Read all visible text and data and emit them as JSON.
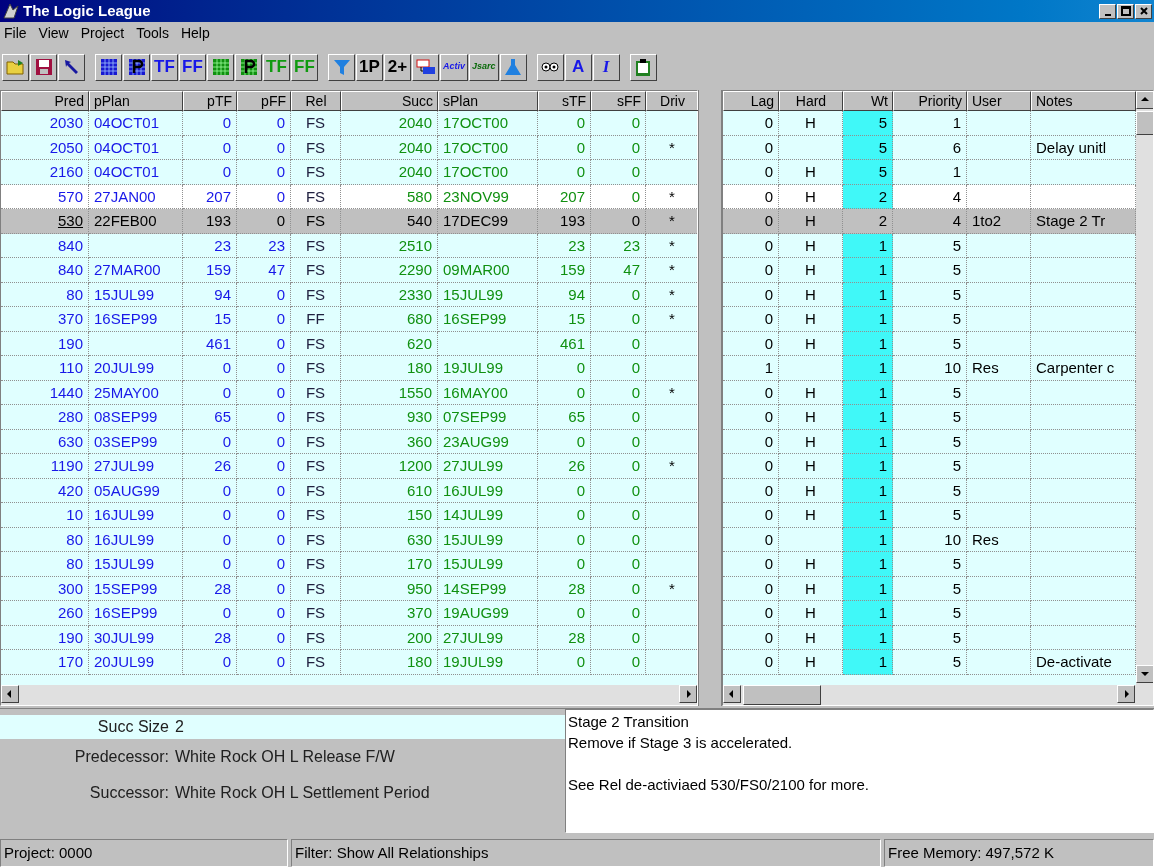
{
  "window": {
    "title": "The Logic League"
  },
  "menu": [
    "File",
    "View",
    "Project",
    "Tools",
    "Help"
  ],
  "toolbar": [
    {
      "kind": "icon"
    },
    {
      "kind": "icon"
    },
    {
      "kind": "icon"
    },
    {
      "kind": "separator"
    },
    {
      "kind": "icon"
    },
    {
      "kind": "icon"
    },
    {
      "kind": "text",
      "label": "TF",
      "color": "#1818e8"
    },
    {
      "kind": "text",
      "label": "FF",
      "color": "#1818e8"
    },
    {
      "kind": "icon"
    },
    {
      "kind": "icon"
    },
    {
      "kind": "text",
      "label": "TF",
      "color": "#109a10"
    },
    {
      "kind": "text",
      "label": "FF",
      "color": "#109a10"
    },
    {
      "kind": "separator"
    },
    {
      "kind": "icon"
    },
    {
      "kind": "text",
      "label": "1P",
      "color": "#000000"
    },
    {
      "kind": "text",
      "label": "2+",
      "color": "#000000"
    },
    {
      "kind": "icon"
    },
    {
      "kind": "small",
      "label": "Activ",
      "color": "#1818e8"
    },
    {
      "kind": "small",
      "label": "Jsarc",
      "color": "#0a6a0a"
    },
    {
      "kind": "icon"
    },
    {
      "kind": "separator"
    },
    {
      "kind": "icon"
    },
    {
      "kind": "text",
      "label": "A",
      "color": "#1818e8"
    },
    {
      "kind": "italic",
      "label": "I",
      "color": "#1818e8"
    },
    {
      "kind": "separator"
    },
    {
      "kind": "icon"
    }
  ],
  "left_grid": {
    "columns": [
      "Pred",
      "pPlan",
      "pTF",
      "pFF",
      "Rel",
      "Succ",
      "sPlan",
      "sTF",
      "sFF",
      "Driv"
    ]
  },
  "right_grid": {
    "columns": [
      "Lag",
      "Hard",
      "Wt",
      "Priority",
      "User",
      "Notes"
    ]
  },
  "rows": [
    {
      "selected": false,
      "highlighted": false,
      "pred": "2030",
      "pplan": "04OCT01",
      "ptf": "0",
      "pff": "0",
      "rel": "FS",
      "succ": "2040",
      "splan": "17OCT00",
      "stf": "0",
      "sff": "0",
      "lag": "0",
      "hard": "H",
      "wt": "5",
      "priority": "1"
    },
    {
      "selected": false,
      "highlighted": false,
      "pred": "2050",
      "pplan": "04OCT01",
      "ptf": "0",
      "pff": "0",
      "rel": "FS",
      "succ": "2040",
      "splan": "17OCT00",
      "stf": "0",
      "sff": "0",
      "driv": "*",
      "lag": "0",
      "wt": "5",
      "priority": "6",
      "notes": "Delay unitl"
    },
    {
      "selected": false,
      "highlighted": false,
      "pred": "2160",
      "pplan": "04OCT01",
      "ptf": "0",
      "pff": "0",
      "rel": "FS",
      "succ": "2040",
      "splan": "17OCT00",
      "stf": "0",
      "sff": "0",
      "lag": "0",
      "hard": "H",
      "wt": "5",
      "priority": "1"
    },
    {
      "selected": false,
      "highlighted": true,
      "pred": "570",
      "pplan": "27JAN00",
      "ptf": "207",
      "pff": "0",
      "rel": "FS",
      "succ": "580",
      "splan": "23NOV99",
      "stf": "207",
      "sff": "0",
      "driv": "*",
      "lag": "0",
      "hard": "H",
      "wt": "2",
      "priority": "4"
    },
    {
      "selected": true,
      "highlighted": false,
      "pred": "530",
      "pplan": "22FEB00",
      "ptf": "193",
      "pff": "0",
      "rel": "FS",
      "succ": "540",
      "splan": "17DEC99",
      "stf": "193",
      "sff": "0",
      "driv": "*",
      "lag": "0",
      "hard": "H",
      "wt": "2",
      "priority": "4",
      "user": "1to2",
      "notes": "Stage 2 Tr"
    },
    {
      "selected": false,
      "highlighted": false,
      "pred": "840",
      "ptf": "23",
      "pff": "23",
      "rel": "FS",
      "succ": "2510",
      "stf": "23",
      "sff": "23",
      "driv": "*",
      "lag": "0",
      "hard": "H",
      "wt": "1",
      "priority": "5"
    },
    {
      "selected": false,
      "highlighted": false,
      "pred": "840",
      "pplan": "27MAR00",
      "ptf": "159",
      "pff": "47",
      "rel": "FS",
      "succ": "2290",
      "splan": "09MAR00",
      "stf": "159",
      "sff": "47",
      "driv": "*",
      "lag": "0",
      "hard": "H",
      "wt": "1",
      "priority": "5"
    },
    {
      "selected": false,
      "highlighted": false,
      "pred": "80",
      "pplan": "15JUL99",
      "ptf": "94",
      "pff": "0",
      "rel": "FS",
      "succ": "2330",
      "splan": "15JUL99",
      "stf": "94",
      "sff": "0",
      "driv": "*",
      "lag": "0",
      "hard": "H",
      "wt": "1",
      "priority": "5"
    },
    {
      "selected": false,
      "highlighted": false,
      "pred": "370",
      "pplan": "16SEP99",
      "ptf": "15",
      "pff": "0",
      "rel": "FF",
      "succ": "680",
      "splan": "16SEP99",
      "stf": "15",
      "sff": "0",
      "driv": "*",
      "lag": "0",
      "hard": "H",
      "wt": "1",
      "priority": "5"
    },
    {
      "selected": false,
      "highlighted": false,
      "pred": "190",
      "ptf": "461",
      "pff": "0",
      "rel": "FS",
      "succ": "620",
      "stf": "461",
      "sff": "0",
      "lag": "0",
      "hard": "H",
      "wt": "1",
      "priority": "5"
    },
    {
      "selected": false,
      "highlighted": false,
      "pred": "110",
      "pplan": "20JUL99",
      "ptf": "0",
      "pff": "0",
      "rel": "FS",
      "succ": "180",
      "splan": "19JUL99",
      "stf": "0",
      "sff": "0",
      "lag": "1",
      "wt": "1",
      "priority": "10",
      "user": "Res",
      "notes": "Carpenter c"
    },
    {
      "selected": false,
      "highlighted": false,
      "pred": "1440",
      "pplan": "25MAY00",
      "ptf": "0",
      "pff": "0",
      "rel": "FS",
      "succ": "1550",
      "splan": "16MAY00",
      "stf": "0",
      "sff": "0",
      "driv": "*",
      "lag": "0",
      "hard": "H",
      "wt": "1",
      "priority": "5"
    },
    {
      "selected": false,
      "highlighted": false,
      "pred": "280",
      "pplan": "08SEP99",
      "ptf": "65",
      "pff": "0",
      "rel": "FS",
      "succ": "930",
      "splan": "07SEP99",
      "stf": "65",
      "sff": "0",
      "lag": "0",
      "hard": "H",
      "wt": "1",
      "priority": "5"
    },
    {
      "selected": false,
      "highlighted": false,
      "pred": "630",
      "pplan": "03SEP99",
      "ptf": "0",
      "pff": "0",
      "rel": "FS",
      "succ": "360",
      "splan": "23AUG99",
      "stf": "0",
      "sff": "0",
      "lag": "0",
      "hard": "H",
      "wt": "1",
      "priority": "5"
    },
    {
      "selected": false,
      "highlighted": false,
      "pred": "1190",
      "pplan": "27JUL99",
      "ptf": "26",
      "pff": "0",
      "rel": "FS",
      "succ": "1200",
      "splan": "27JUL99",
      "stf": "26",
      "sff": "0",
      "driv": "*",
      "lag": "0",
      "hard": "H",
      "wt": "1",
      "priority": "5"
    },
    {
      "selected": false,
      "highlighted": false,
      "pred": "420",
      "pplan": "05AUG99",
      "ptf": "0",
      "pff": "0",
      "rel": "FS",
      "succ": "610",
      "splan": "16JUL99",
      "stf": "0",
      "sff": "0",
      "lag": "0",
      "hard": "H",
      "wt": "1",
      "priority": "5"
    },
    {
      "selected": false,
      "highlighted": false,
      "pred": "10",
      "pplan": "16JUL99",
      "ptf": "0",
      "pff": "0",
      "rel": "FS",
      "succ": "150",
      "splan": "14JUL99",
      "stf": "0",
      "sff": "0",
      "lag": "0",
      "hard": "H",
      "wt": "1",
      "priority": "5"
    },
    {
      "selected": false,
      "highlighted": false,
      "pred": "80",
      "pplan": "16JUL99",
      "ptf": "0",
      "pff": "0",
      "rel": "FS",
      "succ": "630",
      "splan": "15JUL99",
      "stf": "0",
      "sff": "0",
      "lag": "0",
      "wt": "1",
      "priority": "10",
      "user": "Res"
    },
    {
      "selected": false,
      "highlighted": false,
      "pred": "80",
      "pplan": "15JUL99",
      "ptf": "0",
      "pff": "0",
      "rel": "FS",
      "succ": "170",
      "splan": "15JUL99",
      "stf": "0",
      "sff": "0",
      "lag": "0",
      "hard": "H",
      "wt": "1",
      "priority": "5"
    },
    {
      "selected": false,
      "highlighted": false,
      "pred": "300",
      "pplan": "15SEP99",
      "ptf": "28",
      "pff": "0",
      "rel": "FS",
      "succ": "950",
      "splan": "14SEP99",
      "stf": "28",
      "sff": "0",
      "driv": "*",
      "lag": "0",
      "hard": "H",
      "wt": "1",
      "priority": "5"
    },
    {
      "selected": false,
      "highlighted": false,
      "pred": "260",
      "pplan": "16SEP99",
      "ptf": "0",
      "pff": "0",
      "rel": "FS",
      "succ": "370",
      "splan": "19AUG99",
      "stf": "0",
      "sff": "0",
      "lag": "0",
      "hard": "H",
      "wt": "1",
      "priority": "5"
    },
    {
      "selected": false,
      "highlighted": false,
      "pred": "190",
      "pplan": "30JUL99",
      "ptf": "28",
      "pff": "0",
      "rel": "FS",
      "succ": "200",
      "splan": "27JUL99",
      "stf": "28",
      "sff": "0",
      "lag": "0",
      "hard": "H",
      "wt": "1",
      "priority": "5"
    },
    {
      "selected": false,
      "highlighted": false,
      "pred": "170",
      "pplan": "20JUL99",
      "ptf": "0",
      "pff": "0",
      "rel": "FS",
      "succ": "180",
      "splan": "19JUL99",
      "stf": "0",
      "sff": "0",
      "lag": "0",
      "hard": "H",
      "wt": "1",
      "priority": "5",
      "notes": "De-activate"
    }
  ],
  "details": {
    "succ_size_label": "Succ Size",
    "succ_size": "2",
    "predecessor_label": "Predecessor:",
    "predecessor": "White Rock OH L Release F/W",
    "successor_label": "Successor:",
    "successor": "White Rock OH L Settlement Period",
    "notes": [
      [
        "Stage 2 Transition",
        "Remove if Stage 3 is accelerated."
      ],
      [
        "See Rel de-activiaed 530/FS0/2100 for more."
      ]
    ]
  },
  "status_bar": [
    "Project: 0000",
    "Filter: Show All Relationships",
    "Free Memory: 497,572 K"
  ]
}
